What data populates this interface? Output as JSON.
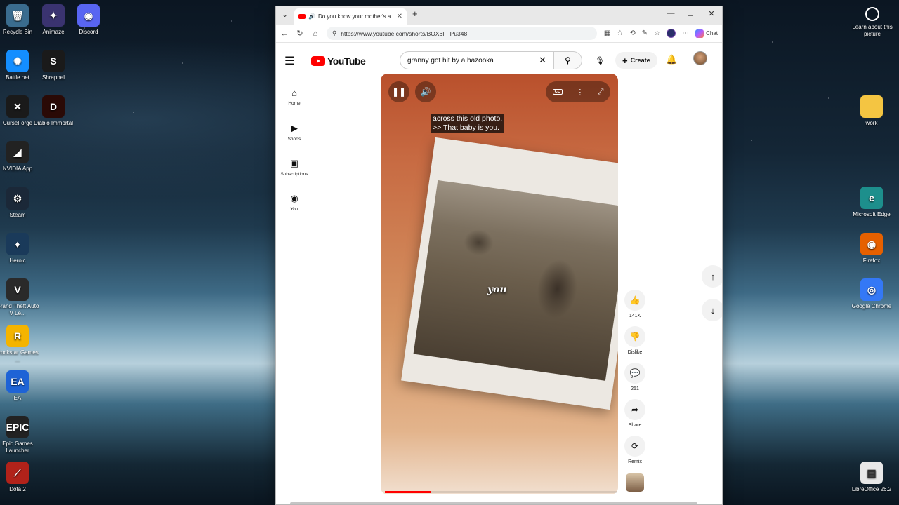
{
  "desktop": {
    "left_icons": [
      {
        "label": "Recycle Bin",
        "glyph": "🗑",
        "color": "#3a6c8f"
      },
      {
        "label": "Animaze",
        "glyph": "✦",
        "color": "#3a3370"
      },
      {
        "label": "Discord",
        "glyph": "◉",
        "color": "#5865f2"
      },
      {
        "label": "Battle.net",
        "glyph": "✺",
        "color": "#148eff"
      },
      {
        "label": "Shrapnel",
        "glyph": "S",
        "color": "#1a1a1a"
      },
      {
        "label": "CurseForge",
        "glyph": "✕",
        "color": "#1a1a1a"
      },
      {
        "label": "Diablo Immortal",
        "glyph": "D",
        "color": "#2a0a06"
      },
      {
        "label": "NVIDIA App",
        "glyph": "◢",
        "color": "#222"
      },
      {
        "label": "Steam",
        "glyph": "⚙",
        "color": "#1b2838"
      },
      {
        "label": "Heroic",
        "glyph": "♦",
        "color": "#1a3a5a"
      },
      {
        "label": "Grand Theft Auto V Le...",
        "glyph": "V",
        "color": "#2a2a2a"
      },
      {
        "label": "Rockstar Games ...",
        "glyph": "R",
        "color": "#f4b400"
      },
      {
        "label": "EA",
        "glyph": "EA",
        "color": "#1e63d6"
      },
      {
        "label": "Epic Games Launcher",
        "glyph": "EPIC",
        "color": "#222"
      },
      {
        "label": "Dota 2",
        "glyph": "⟋",
        "color": "#b1221a"
      }
    ],
    "right_icons": [
      {
        "label": "work",
        "glyph": "",
        "color": "#f4c542"
      },
      {
        "label": "Microsoft Edge",
        "glyph": "e",
        "color": "#1d8f8c"
      },
      {
        "label": "Firefox",
        "glyph": "◉",
        "color": "#e66000"
      },
      {
        "label": "Google Chrome",
        "glyph": "◎",
        "color": "#3478f6"
      },
      {
        "label": "LibreOffice 26.2",
        "glyph": "▤",
        "color": "#e8e8e8"
      }
    ],
    "learn_label": "Learn about this picture"
  },
  "browser": {
    "tab_title": "Do you know your mother's a",
    "url": "https://www.youtube.com/shorts/BOX6FFPu348",
    "chat_label": "Chat"
  },
  "youtube": {
    "logo_text": "YouTube",
    "search_value": "granny got hit by a bazooka",
    "create_label": "Create",
    "sidebar": [
      {
        "label": "Home",
        "icon": "⌂"
      },
      {
        "label": "Shorts",
        "icon": "▶"
      },
      {
        "label": "Subscriptions",
        "icon": "▣"
      },
      {
        "label": "You",
        "icon": "◉"
      }
    ],
    "captions": [
      "across this old photo.",
      ">> That baby is you."
    ],
    "overlay_word": "you",
    "progress": 0.2,
    "actions": {
      "like_count": "141K",
      "dislike_label": "Dislike",
      "comment_count": "251",
      "share_label": "Share",
      "remix_label": "Remix"
    }
  }
}
